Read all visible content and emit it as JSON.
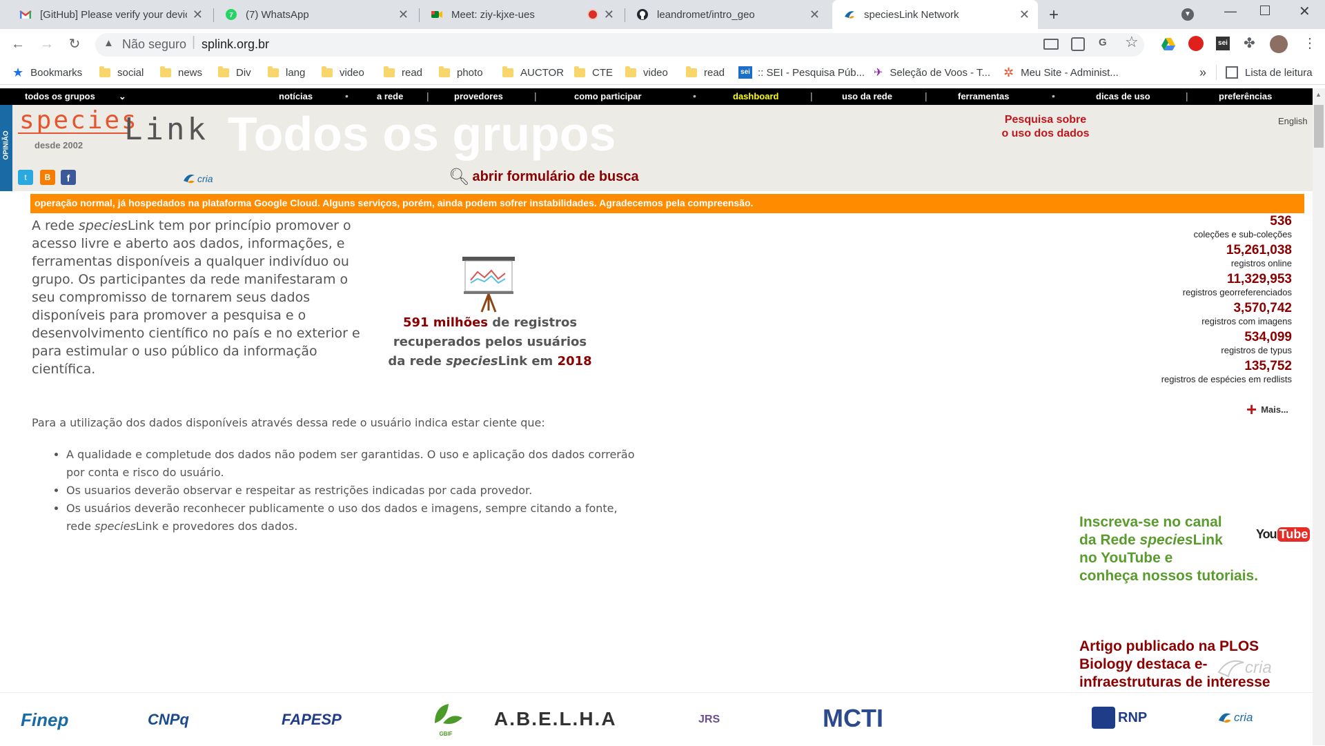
{
  "browser": {
    "tabs": [
      {
        "title": "[GitHub] Please verify your devic",
        "icon": "gmail-icon"
      },
      {
        "title": "(7) WhatsApp",
        "icon": "whatsapp-icon"
      },
      {
        "title": "Meet: ziy-kjxe-ues",
        "icon": "meet-icon"
      },
      {
        "title": "leandromet/intro_geo",
        "icon": "github-icon"
      },
      {
        "title": "speciesLink Network",
        "icon": "specieslink-icon"
      }
    ],
    "security_label": "Não seguro",
    "url": "splink.org.br",
    "bookmarks_label": "Bookmarks",
    "bookmarks": [
      "social",
      "news",
      "Div",
      "lang",
      "video",
      "read",
      "photo",
      "AUCTOR",
      "CTE",
      "video",
      "read",
      ":: SEI - Pesquisa Púb...",
      "Seleção de Voos - T...",
      "Meu Site - Administ..."
    ],
    "reading_list": "Lista de leitura"
  },
  "menu": {
    "groups": "todos os grupos",
    "items": [
      "notícias",
      "a rede",
      "provedores",
      "como participar",
      "dashboard",
      "uso da rede",
      "ferramentas",
      "dicas de uso",
      "preferências"
    ]
  },
  "header": {
    "logo_species": "species",
    "logo_link": "Link",
    "since": "desde 2002",
    "title": "Todos os grupos",
    "survey": "Pesquisa sobre\no uso dos dados",
    "language": "English",
    "side_tab": "OPINIÃO",
    "search_link": "abrir formulário de busca",
    "cria": "cria"
  },
  "ticker": "operação normal, já hospedados na plataforma Google Cloud. Alguns serviços, porém, ainda podem sofrer instabilidades. Agradecemos pela compreensão.",
  "intro": {
    "p1_a": "A rede ",
    "p1_species": "species",
    "p1_b": "Link tem por princípio promover o acesso livre e aberto aos dados, informações, e ferramentas disponíveis a qualquer indivíduo ou grupo. Os participantes da rede manifestaram o seu compromisso de tornarem seus dados disponíveis para promover a pesquisa e o desenvolvimento científico no país e no exterior e para estimular o uso público da informação científica.",
    "p2": "Para a utilização dos dados disponíveis através dessa rede o usuário indica estar ciente que:",
    "bullets": [
      "A qualidade e completude dos dados não podem ser garantidas. O uso e aplicação dos dados correrão por conta e risco do usuário.",
      "Os usuarios deverão observar e respeitar as restrições indicadas por cada provedor.",
      "Os usuários deverão reconhecer publicamente o uso dos dados e imagens, sempre citando a fonte, rede "
    ],
    "bullet3_species": "species",
    "bullet3_end": "Link e provedores dos dados."
  },
  "promo": {
    "num": "591 milhões",
    "t1": " de registros",
    "t2": "recuperados pelos usuários",
    "t3": "da rede ",
    "species": "species",
    "t4": "Link em ",
    "year": "2018"
  },
  "stats": [
    {
      "value": "536",
      "label": "coleções e sub-coleções"
    },
    {
      "value": "15,261,038",
      "label": "registros online"
    },
    {
      "value": "11,329,953",
      "label": "registros georreferenciados"
    },
    {
      "value": "3,570,742",
      "label": "registros com imagens"
    },
    {
      "value": "534,099",
      "label": "registros de typus"
    },
    {
      "value": "135,752",
      "label": "registros de espécies em redlists"
    }
  ],
  "more": "Mais...",
  "youtube": {
    "l1": "Inscreva-se no canal",
    "l2a": "da Rede ",
    "l2b": "species",
    "l2c": "Link",
    "l3": "no YouTube e",
    "l4": "conheça nossos tutoriais.",
    "logo_you": "You",
    "logo_tube": "Tube"
  },
  "article": {
    "l1": "Artigo publicado na PLOS",
    "l2": "Biology destaca e-",
    "l3": "infraestruturas de interesse"
  },
  "footer_logos": [
    "Finep",
    "CNPq",
    "FAPESP",
    "GBIF",
    "A.B.E.L.H.A",
    "JRS",
    "MCTI",
    "RNP",
    "cria"
  ],
  "colors": {
    "accent_red": "#8b0000",
    "ticker": "#ff8c00",
    "youtube_green": "#5a9b2e",
    "dashboard": "#ffff00"
  }
}
